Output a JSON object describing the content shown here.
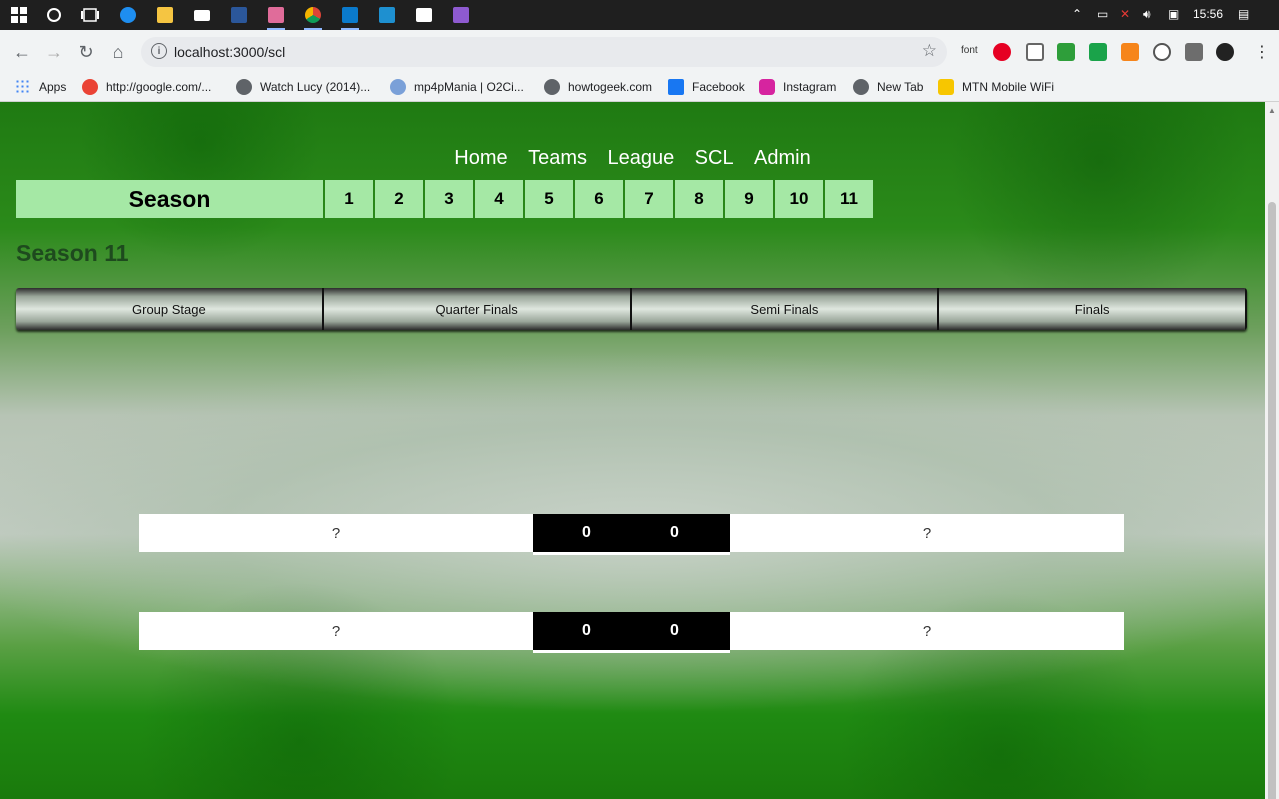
{
  "taskbar": {
    "time": "15:56",
    "apps": [
      "windows-start",
      "search",
      "task-view",
      "edge",
      "file-explorer",
      "mail",
      "word",
      "paint",
      "chrome",
      "vscode",
      "app-blue",
      "store",
      "app-purple"
    ]
  },
  "browser": {
    "url": "localhost:3000/scl",
    "ext_font_label": "font",
    "bookmarks": [
      {
        "label": "Apps",
        "icon": "apps-grid-icon",
        "color": "#4285f4"
      },
      {
        "label": "http://google.com/...",
        "icon": "google-icon",
        "color": "#ea4335"
      },
      {
        "label": "Watch Lucy (2014)...",
        "icon": "globe-icon",
        "color": "#5f6368"
      },
      {
        "label": "mp4pMania | O2Ci...",
        "icon": "mp4pmania-icon",
        "color": "#7aa0d8"
      },
      {
        "label": "howtogeek.com",
        "icon": "globe-icon",
        "color": "#5f6368"
      },
      {
        "label": "Facebook",
        "icon": "facebook-icon",
        "color": "#1877f2"
      },
      {
        "label": "Instagram",
        "icon": "instagram-icon",
        "color": "#d6249f"
      },
      {
        "label": "New Tab",
        "icon": "globe-icon",
        "color": "#5f6368"
      },
      {
        "label": "MTN Mobile WiFi",
        "icon": "mtn-icon",
        "color": "#f7c600"
      }
    ]
  },
  "page": {
    "nav": [
      "Home",
      "Teams",
      "League",
      "SCL",
      "Admin"
    ],
    "season_label": "Season",
    "seasons": [
      "1",
      "2",
      "3",
      "4",
      "5",
      "6",
      "7",
      "8",
      "9",
      "10",
      "11"
    ],
    "season_title": "Season 11",
    "stages": [
      "Group Stage",
      "Quarter Finals",
      "Semi Finals",
      "Finals"
    ],
    "matches": [
      {
        "home": "?",
        "home_score": "0",
        "away_score": "0",
        "away": "?"
      },
      {
        "home": "?",
        "home_score": "0",
        "away_score": "0",
        "away": "?"
      }
    ]
  }
}
